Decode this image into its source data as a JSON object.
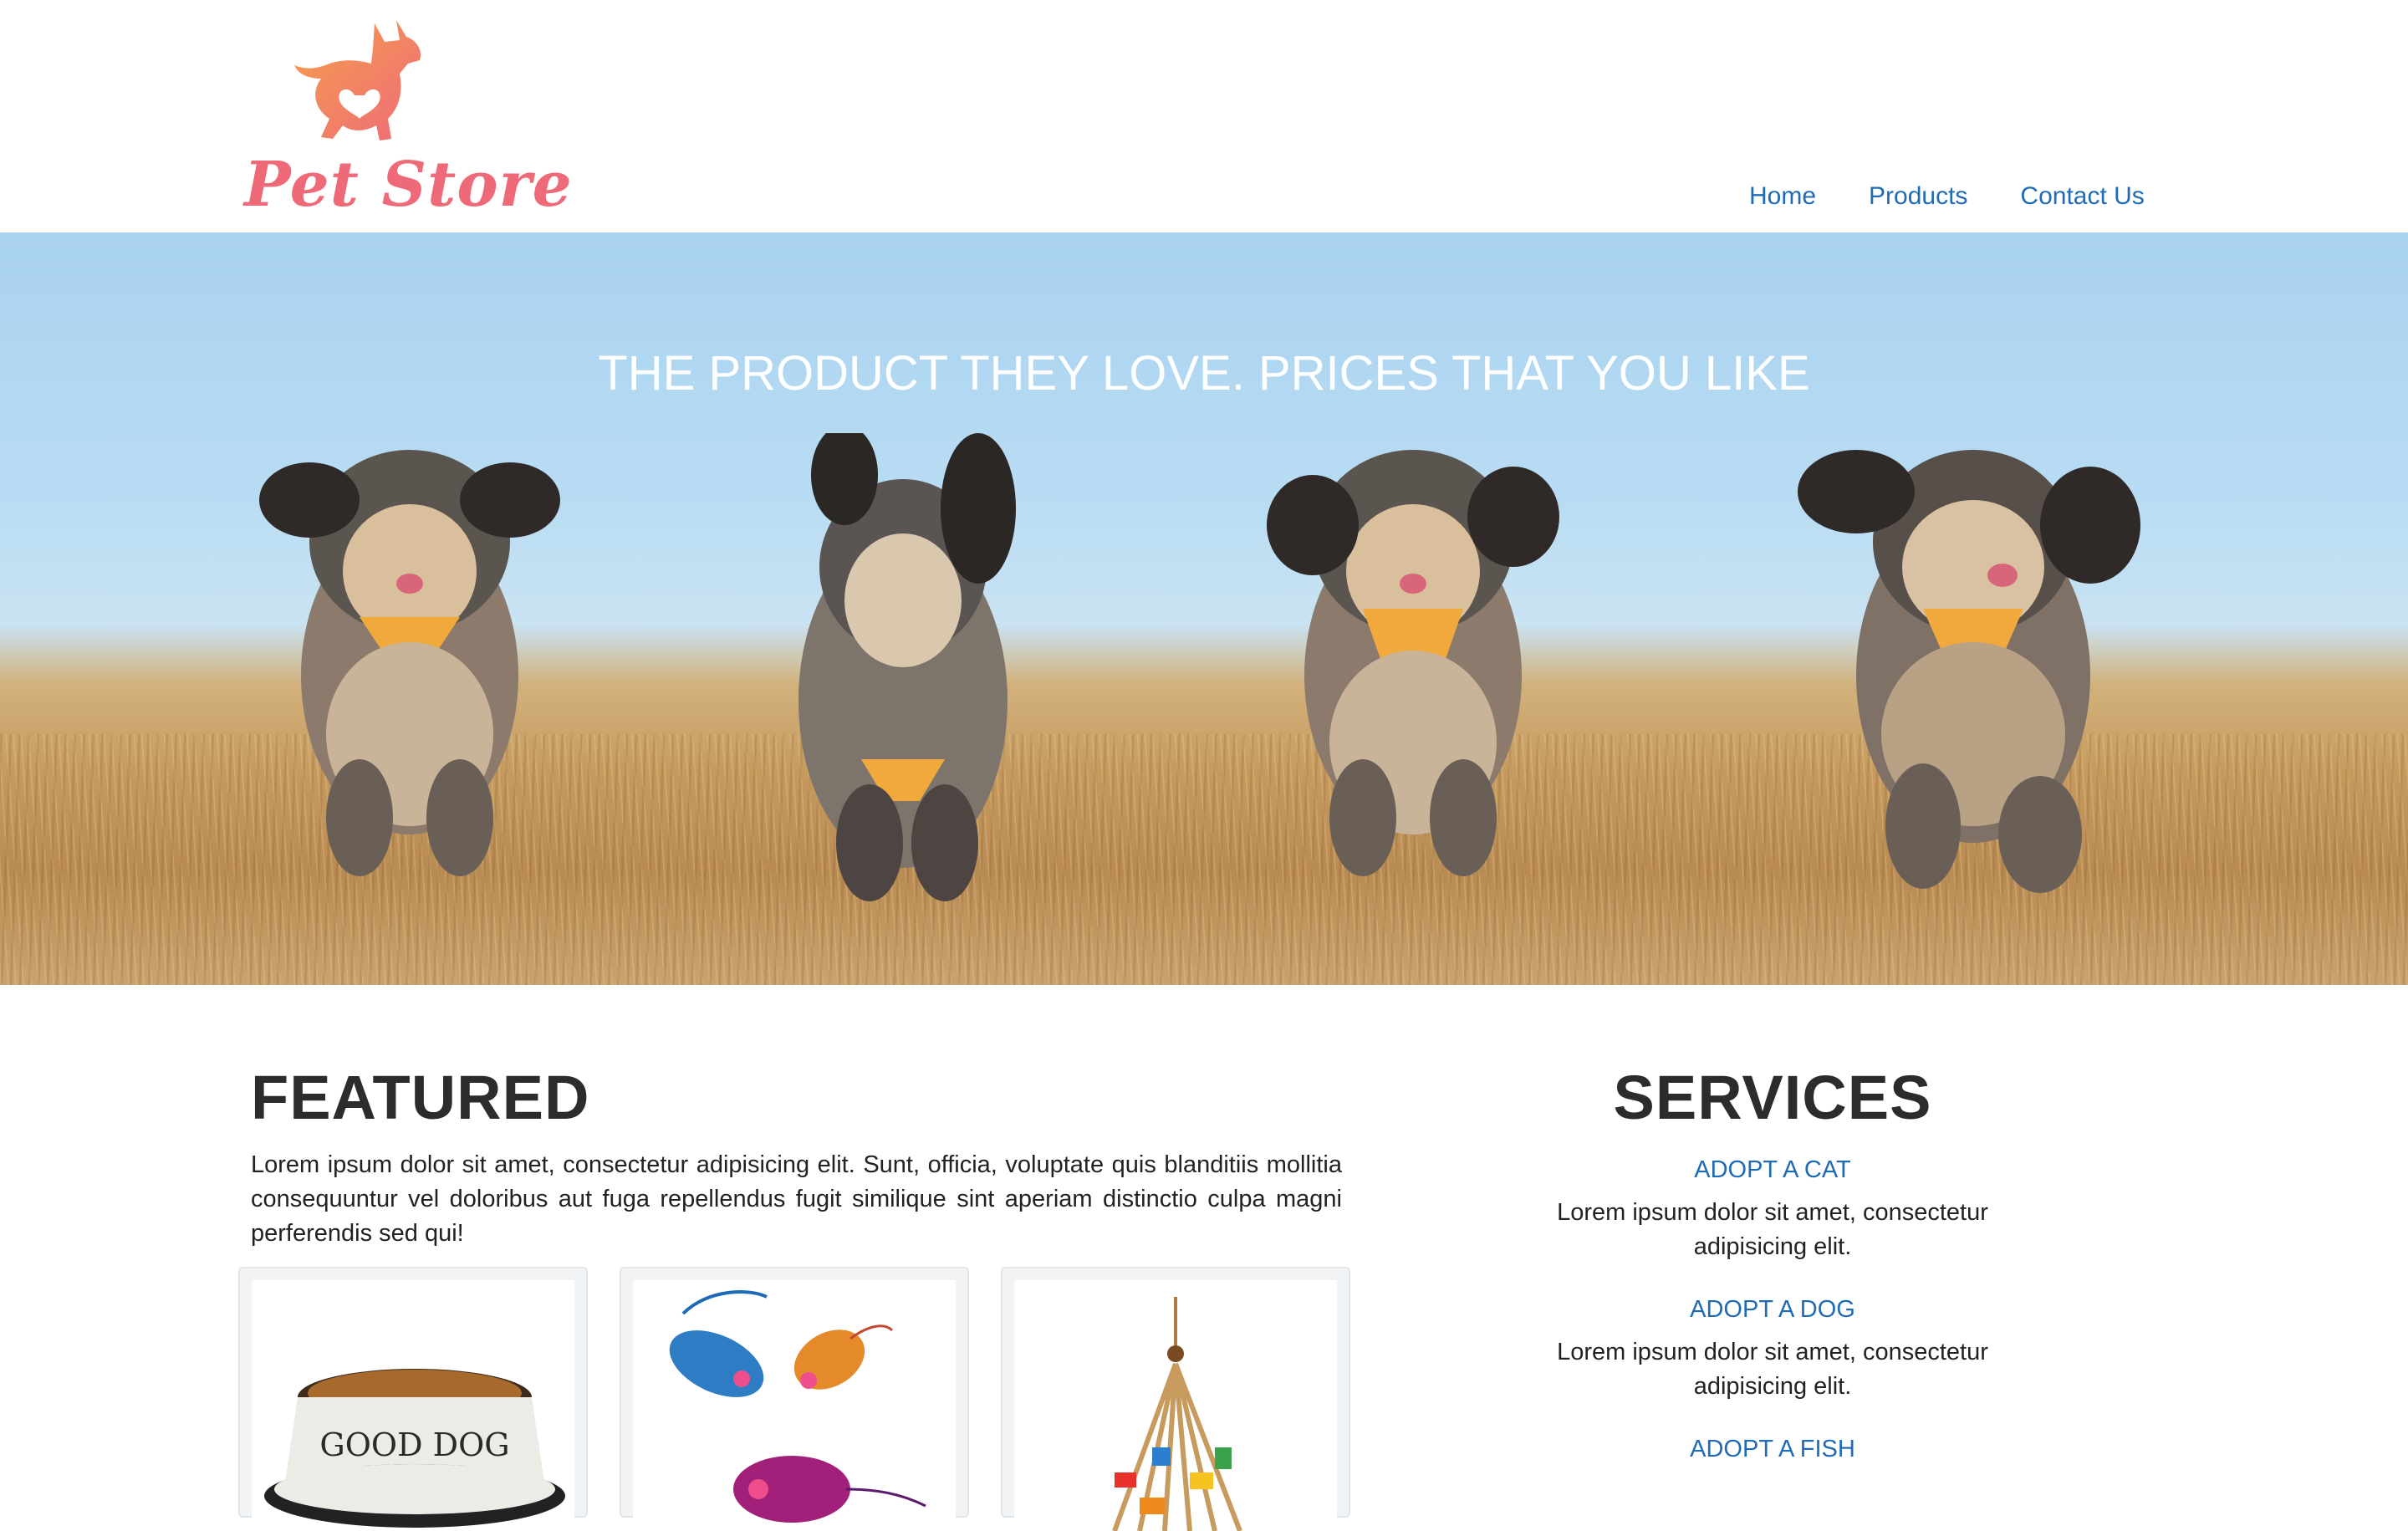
{
  "brand": {
    "name": "Pet Store",
    "logo_icon": "dog-icon",
    "logo_colors": [
      "#f6a04d",
      "#ee6a78"
    ]
  },
  "nav": {
    "items": [
      {
        "label": "Home"
      },
      {
        "label": "Products"
      },
      {
        "label": "Contact Us"
      }
    ],
    "link_color": "#1f6bb6"
  },
  "hero": {
    "title": "THE PRODUCT THEY LOVE. PRICES THAT YOU LIKE"
  },
  "featured": {
    "heading": "FEATURED",
    "body": "Lorem ipsum dolor sit amet, consectetur adipisicing elit. Sunt, officia, voluptate quis blanditiis mollitia consequuntur vel doloribus aut fuga repellendus fugit similique sint aperiam distinctio culpa magni perferendis sed qui!",
    "products": [
      {
        "image": "dog-bowl-image",
        "bowl_text": "GOOD DOG"
      },
      {
        "image": "cat-toy-mice-image"
      },
      {
        "image": "bird-toy-image"
      }
    ]
  },
  "services": {
    "heading": "SERVICES",
    "items": [
      {
        "label": "ADOPT A CAT",
        "desc": "Lorem ipsum dolor sit amet, consectetur adipisicing elit."
      },
      {
        "label": "ADOPT A DOG",
        "desc": "Lorem ipsum dolor sit amet, consectetur adipisicing elit."
      },
      {
        "label": "ADOPT A FISH",
        "desc": ""
      }
    ]
  }
}
